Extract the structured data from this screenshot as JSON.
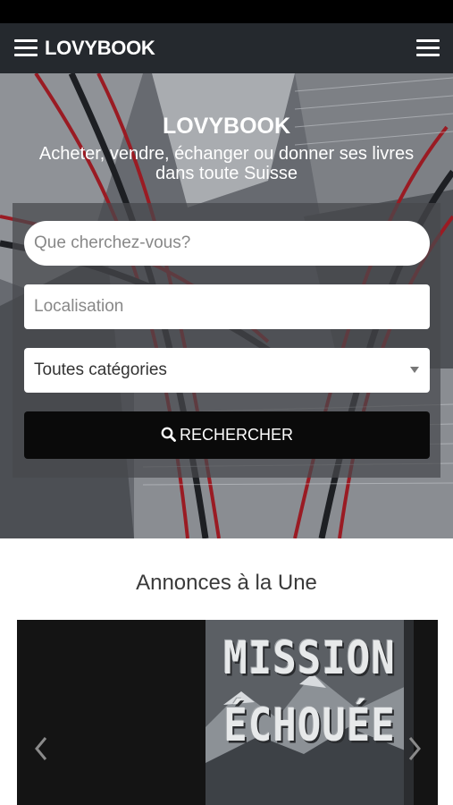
{
  "navbar": {
    "brand": "LOVYBOOK"
  },
  "hero": {
    "title": "LOVYBOOK",
    "subtitle": "Acheter, vendre, échanger ou donner ses livres dans toute Suisse"
  },
  "search": {
    "query_placeholder": "Que cherchez-vous?",
    "location_placeholder": "Localisation",
    "category_selected": "Toutes catégories",
    "button_label": "RECHERCHER"
  },
  "featured": {
    "title": "Annonces à la Une",
    "cover_line1": "MISSION",
    "cover_line2": "ÉCHOUÉE"
  },
  "icons": {
    "menu": "hamburger-icon",
    "options": "hamburger-icon",
    "search": "search-icon",
    "prev": "chevron-left-icon",
    "next": "chevron-right-icon"
  }
}
